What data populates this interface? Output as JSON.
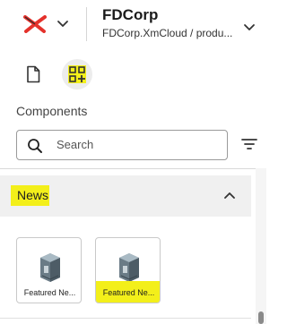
{
  "header": {
    "tenant_name": "FDCorp",
    "tenant_path": "FDCorp.XmCloud / produ...",
    "logo_color": "#e4312b"
  },
  "tabs": [
    {
      "icon": "page-icon",
      "active": false
    },
    {
      "icon": "add-component-icon",
      "active": true
    }
  ],
  "panel": {
    "title": "Components",
    "search_placeholder": "Search"
  },
  "groups": [
    {
      "label": "News",
      "expanded": true,
      "items": [
        {
          "label": "Featured Ne...",
          "icon": "component-box-icon"
        },
        {
          "label": "Featured Ne...",
          "icon": "component-box-icon"
        }
      ]
    }
  ],
  "colors": {
    "highlight": "#f3ef1a",
    "accent": "#e4312b"
  }
}
